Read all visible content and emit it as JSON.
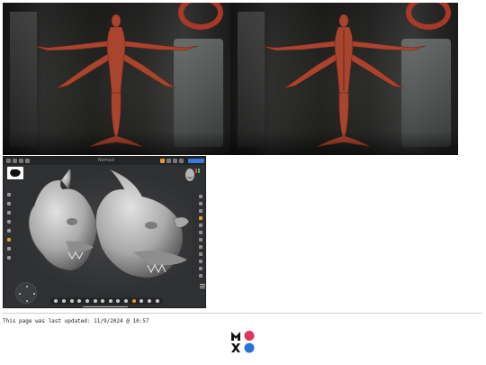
{
  "renders": [
    {
      "view": "front",
      "subject": "red mermaid sculpture, T-pose"
    },
    {
      "view": "back",
      "subject": "red mermaid sculpture, T-pose"
    }
  ],
  "app": {
    "title": "Nomad",
    "reference_label": "",
    "toolbar_icons": [
      "menu-icon",
      "file-icon",
      "scene-icon",
      "settings-icon",
      "undo-icon",
      "redo-icon",
      "layers-icon",
      "camera-icon"
    ],
    "bottom_tools": [
      "clay-icon",
      "brush-icon",
      "inflate-icon",
      "smooth-icon",
      "crease-icon",
      "flatten-icon",
      "pinch-icon",
      "mask-icon",
      "move-icon",
      "drag-icon",
      "trim-icon",
      "paint-icon",
      "symmetry-icon",
      "subdivide-icon"
    ],
    "sculpt_subject": "two grey demon/ogre head busts"
  },
  "footer": {
    "updated_text": "This page was last updated: 11/9/2024 @ 10:57"
  },
  "colors": {
    "clay_red": "#a9452f",
    "sculpt_grey": "#b9b9b9",
    "logo_dark": "#111111",
    "logo_pink": "#e0335f",
    "logo_blue": "#2a72d8",
    "app_accent": "#e79a2b"
  }
}
